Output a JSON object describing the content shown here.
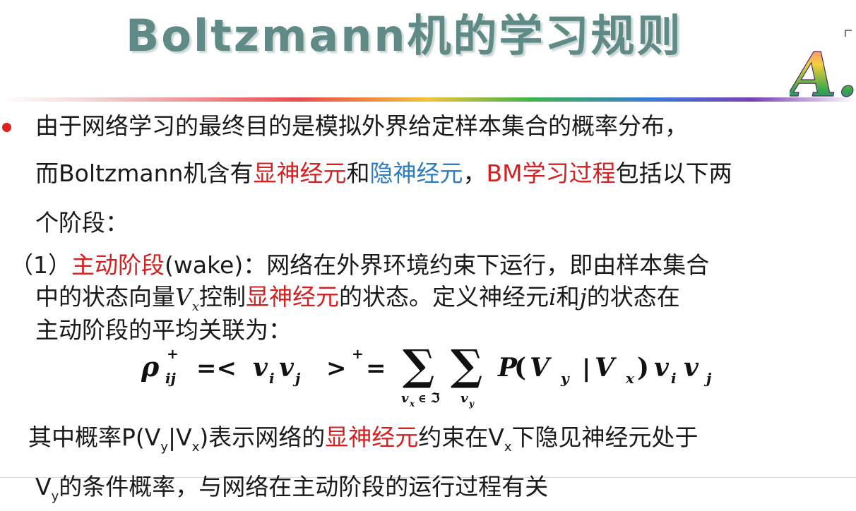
{
  "slide": {
    "title": "Boltzmann机的学习规则",
    "logo_text": "A.I",
    "accent_red": "#d42020",
    "accent_blue": "#2f7cc0",
    "title_color": "#5f8a86"
  },
  "para1": {
    "line1": "由于网络学习的最终目的是模拟外界给定样本集合的概率分布，",
    "line2_a": "而Boltzmann机含有",
    "line2_b": "显神经元",
    "line2_c": "和",
    "line2_d": "隐神经元",
    "line2_e": "，",
    "line2_f": "BM学习过程",
    "line2_g": "包括以下两",
    "line3": "个阶段："
  },
  "para2": {
    "prefix": "（1）",
    "phase_name": "主动阶段",
    "line1_rest": "(wake)：网络在外界环境约束下运行，即由样本集合",
    "line2_a": "中的状态向量",
    "var_V": "V",
    "var_x": "x",
    "line2_b": "控制",
    "line2_c": "显神经元",
    "line2_d": "的状态。定义神经元",
    "var_i": "i",
    "line2_e": "和",
    "var_j": "j",
    "line2_f": "的状态在",
    "line3": "主动阶段的平均关联为："
  },
  "formula": {
    "rho": "ρ",
    "plus": "+",
    "ij": "ij",
    "eq_lt": "=<",
    "v": "v",
    "i": "i",
    "j": "j",
    "gt": ">",
    "eq": "=",
    "sum": "∑",
    "sum1_sub": "v",
    "sum1_sub_x": "x",
    "sum1_in": "∈",
    "sum1_set": "ℑ",
    "sum2_sub": "v",
    "sum2_sub_y": "y",
    "P": "P",
    "lparen": "(",
    "V": "V",
    "y": "y",
    "bar": "|",
    "x": "x",
    "rparen": ")"
  },
  "para3": {
    "line1_a": "其中概率P(V",
    "sub_y": "y",
    "line1_b": "|V",
    "sub_x": "x",
    "line1_c": ")表示网络的",
    "line1_d": "显神经元",
    "line1_e": "约束在V",
    "line1_f": "下隐见神经元处于",
    "line2_a": "V",
    "line2_b": "的条件概率，与网络在主动阶段的运行过程有关"
  }
}
